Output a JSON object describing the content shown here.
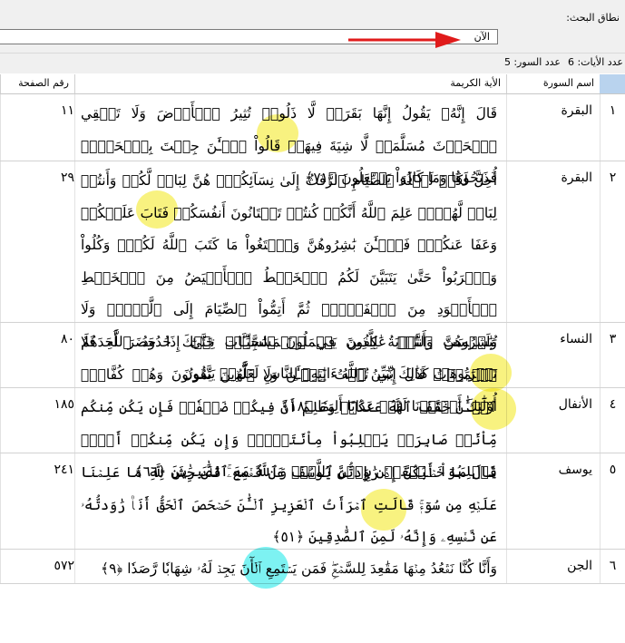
{
  "search": {
    "label": "نطاق البحث:",
    "value": "الآن",
    "arrow_color": "#e01b1b"
  },
  "counts": {
    "verses_label": "عدد الأيات:",
    "verses_value": "6",
    "suras_label": "عدد السور:",
    "suras_value": "5"
  },
  "table": {
    "columns": {
      "sura": "اسم السورة",
      "verse": "الأية الكريمة",
      "page": "رقم الصفحة"
    },
    "rows": [
      {
        "n": "١",
        "sura": "البقرة",
        "page": "١١",
        "verse": "قَالَ إِنَّهُۥ يَقُولُ إِنَّهَا بَقَرَةٞ لَّا ذَلُولٞ تُثِيرُ ٱلۡأَرۡضَ وَلَا تَسۡقِي ٱلۡحَرۡثَ مُسَلَّمَةٞ لَّا شِيَةَ فِيهَاۚ قَالُواْ ٱلۡـَٰٔنَ جِئۡتَ بِٱلۡحَقِّۚ فَذَبَحُوهَا وَمَا كَادُواْ يَفۡعَلُونَ ﴿٧١﴾"
      },
      {
        "n": "٢",
        "sura": "البقرة",
        "page": "٢٩",
        "verse": "أُحِلَّ لَكُمۡ لَيۡلَةَ ٱلصِّيَامِ ٱلرَّفَثُ إِلَىٰ نِسَآئِكُمۡۚ هُنَّ لِبَاسٞ لَّكُمۡ وَأَنتُمۡ لِبَاسٞ لَّهُنَّۗ عَلِمَ ٱللَّهُ أَنَّكُمۡ كُنتُمۡ تَخۡتَانُونَ أَنفُسَكُمۡ فَتَابَ عَلَيۡكُمۡ وَعَفَا عَنكُمۡۖ فَٱلۡـَٰٔنَ بَٰشِرُوهُنَّ وَٱبۡتَغُواْ مَا كَتَبَ ٱللَّهُ لَكُمۡۚ وَكُلُواْ وَٱشۡرَبُواْ حَتَّىٰ يَتَبَيَّنَ لَكُمُ ٱلۡخَيۡطُ ٱلۡأَبۡيَضُ مِنَ ٱلۡخَيۡطِ ٱلۡأَسۡوَدِ مِنَ ٱلۡفَجۡرِۖ ثُمَّ أَتِمُّواْ ٱلصِّيَامَ إِلَى ٱلَّيۡلِۚ وَلَا تُبَٰشِرُوهُنَّ وَأَنتُمۡ عَٰكِفُونَ فِي ٱلۡمَسَٰجِدِۗ تِلۡكَ حُدُودُ ٱللَّهِ فَلَا تَقۡرَبُوهَاۗ كَذَٰلِكَ يُبَيِّنُ ٱللَّهُ ءَايَٰتِهِۦ لِلنَّاسِ لَعَلَّهُمۡ يَتَّقُونَ"
      },
      {
        "n": "٣",
        "sura": "النساء",
        "page": "٨٠",
        "verse": "وَلَيۡسَتِ ٱلتَّوۡبَةُ لِلَّذِينَ يَعۡمَلُونَ ٱلسَّيِّـَٔاتِ حَتَّىٰٓ إِذَا حَضَرَ أَحَدَهُمُ ٱلۡمَوۡتُ قَالَ إِنِّي تُبۡتُ ٱلۡـَٰٔنَ وَلَا ٱلَّذِينَ يَمُوتُونَ وَهُمۡ كُفَّارٌۚ أُوْلَٰٓئِكَ أَعۡتَدۡنَا لَهُمۡ عَذَابًا أَلِيمٗا ﴿١٨﴾"
      },
      {
        "n": "٤",
        "sura": "الأنفال",
        "page": "١٨٥",
        "verse": "ٱلۡـَٰٔنَ خَفَّفَ ٱللَّهُ عَنكُمۡ وَعَلِمَ أَنَّ فِيكُمۡ ضَعۡفٗاۚ فَإِن يَكُن مِّنكُم مِّاْئَةٞ صَابِرَةٞ يَغۡلِبُواْ مِاْئَتَيۡنِۚ وَإِن يَكُن مِّنكُمۡ أَلۡفٞ يَغۡلِبُوٓاْ أَلۡفَيۡنِ بِإِذۡنِ ٱللَّهِۗ وَٱللَّهُ مَعَ ٱلصَّٰبِرِينَ ﴿٦٦﴾"
      },
      {
        "n": "٥",
        "sura": "يوسف",
        "page": "٢٤١",
        "verse": "قَالَ مَا خَطۡبُكُنَّ إِذۡ رَٰوَدتُّنَّ يُوسُفَ عَن نَّفۡسِهِۦۚ قُلۡنَ حَٰشَ لِلَّهِ مَا عَلِمۡنَا عَلَيۡهِ مِن سُوٓءٖۚ قَالَتِ ٱمۡرَأَتُ ٱلۡعَزِيزِ ٱلۡـَٰٔنَ حَصۡحَصَ ٱلۡحَقُّ أَنَا۠ رَٰوَدتُّهُۥ عَن نَّفۡسِهِۦ وَإِنَّهُۥ لَمِنَ ٱلصَّٰدِقِينَ ﴿٥١﴾"
      },
      {
        "n": "٦",
        "sura": "الجن",
        "page": "٥٧٢",
        "verse": "وَأَنَّا كُنَّا نَقۡعُدُ مِنۡهَا مَقَٰعِدَ لِلسَّمۡعِۖ فَمَن يَسۡتَمِعِ ٱلۡأٓنَ يَجِدۡ لَهُۥ شِهَابٗا رَّصَدٗا ﴿٩﴾"
      }
    ]
  },
  "highlight_colors": {
    "match": "#f7f06a",
    "selected": "#66f0f0"
  }
}
